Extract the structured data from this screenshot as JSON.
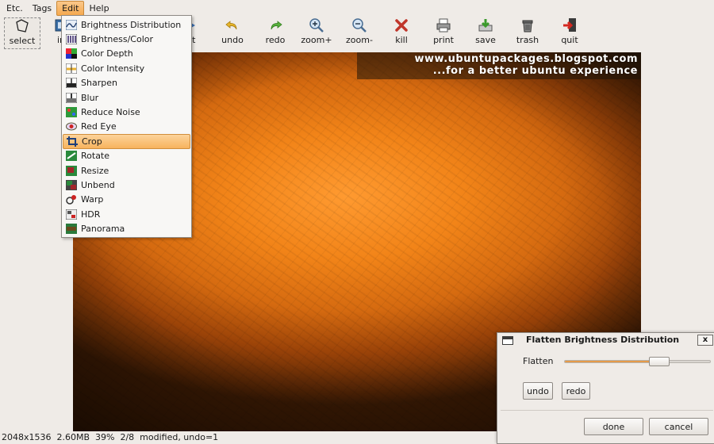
{
  "menubar": {
    "items": [
      "Etc.",
      "Tags",
      "Edit",
      "Help"
    ],
    "active": "Edit"
  },
  "toolbar": {
    "tools": [
      {
        "label": "select",
        "icon": "select-icon"
      },
      {
        "label": "in",
        "icon": "image-info-icon"
      },
      {
        "label": "xt",
        "icon": "next-icon"
      },
      {
        "label": "undo",
        "icon": "undo-icon"
      },
      {
        "label": "redo",
        "icon": "redo-icon"
      },
      {
        "label": "zoom+",
        "icon": "zoom-in-icon"
      },
      {
        "label": "zoom-",
        "icon": "zoom-out-icon"
      },
      {
        "label": "kill",
        "icon": "kill-icon"
      },
      {
        "label": "print",
        "icon": "printer-icon"
      },
      {
        "label": "save",
        "icon": "save-icon"
      },
      {
        "label": "trash",
        "icon": "trash-icon"
      },
      {
        "label": "quit",
        "icon": "quit-icon"
      }
    ]
  },
  "edit_menu": {
    "items": [
      {
        "label": "Brightness Distribution",
        "icon": "brightness-distribution-icon"
      },
      {
        "label": "Brightness/Color",
        "icon": "brightness-color-icon"
      },
      {
        "label": "Color Depth",
        "icon": "color-depth-icon"
      },
      {
        "label": "Color Intensity",
        "icon": "color-intensity-icon"
      },
      {
        "label": "Sharpen",
        "icon": "sharpen-icon"
      },
      {
        "label": "Blur",
        "icon": "blur-icon"
      },
      {
        "label": "Reduce Noise",
        "icon": "reduce-noise-icon"
      },
      {
        "label": "Red Eye",
        "icon": "red-eye-icon"
      },
      {
        "label": "Crop",
        "icon": "crop-icon"
      },
      {
        "label": "Rotate",
        "icon": "rotate-icon"
      },
      {
        "label": "Resize",
        "icon": "resize-icon"
      },
      {
        "label": "Unbend",
        "icon": "unbend-icon"
      },
      {
        "label": "Warp",
        "icon": "warp-icon"
      },
      {
        "label": "HDR",
        "icon": "hdr-icon"
      },
      {
        "label": "Panorama",
        "icon": "panorama-icon"
      }
    ],
    "highlighted": "Crop"
  },
  "image": {
    "watermark_line1": "www.ubuntupackages.blogspot.com",
    "watermark_line2": "...for a better ubuntu experience"
  },
  "statusbar": {
    "text": "2048x1536  2.60MB  39%  2/8  modified, undo=1"
  },
  "dialog": {
    "title": "Flatten Brightness Distribution",
    "close_label": "x",
    "slider_label": "Flatten",
    "slider_value_fraction": 0.6,
    "undo_label": "undo",
    "redo_label": "redo",
    "done_label": "done",
    "cancel_label": "cancel"
  },
  "colors": {
    "menu_highlight": "#f7b35d",
    "slider_fill": "#e59a4a"
  }
}
